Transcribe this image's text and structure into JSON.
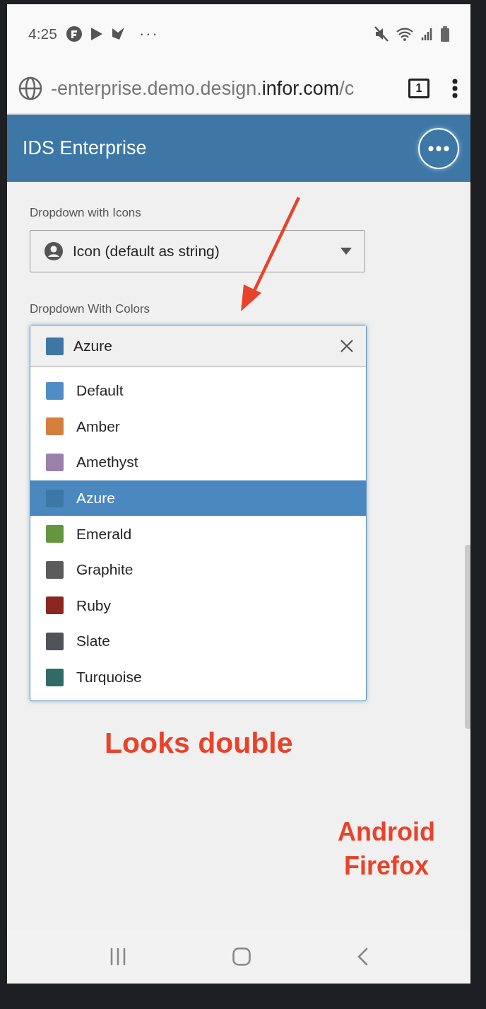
{
  "status_bar": {
    "time": "4:25",
    "more": "···"
  },
  "browser": {
    "url_parts": [
      {
        "text": "-enterprise.demo.design.",
        "kind": "muted"
      },
      {
        "text": "infor.com",
        "kind": "host"
      },
      {
        "text": "/c",
        "kind": "muted"
      }
    ],
    "tab_count": "1"
  },
  "app_header": {
    "title": "IDS Enterprise"
  },
  "fields": [
    {
      "label": "Dropdown with Icons",
      "kind": "icon-select",
      "value": "Icon (default as string)"
    },
    {
      "label": "Dropdown With Colors",
      "kind": "color-select",
      "value": "Azure",
      "color": "#3d77a6",
      "expanded": true,
      "options": [
        {
          "label": "Default",
          "color": "#4f8dc4",
          "selected": false
        },
        {
          "label": "Amber",
          "color": "#d57f3d",
          "selected": false
        },
        {
          "label": "Amethyst",
          "color": "#9a80ab",
          "selected": false
        },
        {
          "label": "Azure",
          "color": "#3d77a6",
          "selected": true
        },
        {
          "label": "Emerald",
          "color": "#65953d",
          "selected": false
        },
        {
          "label": "Graphite",
          "color": "#5b5b5b",
          "selected": false
        },
        {
          "label": "Ruby",
          "color": "#8b2620",
          "selected": false
        },
        {
          "label": "Slate",
          "color": "#50535a",
          "selected": false
        },
        {
          "label": "Turquoise",
          "color": "#326b66",
          "selected": false
        }
      ]
    }
  ],
  "annotations": [
    {
      "text": "Looks double",
      "kind": "note"
    },
    {
      "text": "Android Firefox",
      "kind": "tag"
    }
  ]
}
